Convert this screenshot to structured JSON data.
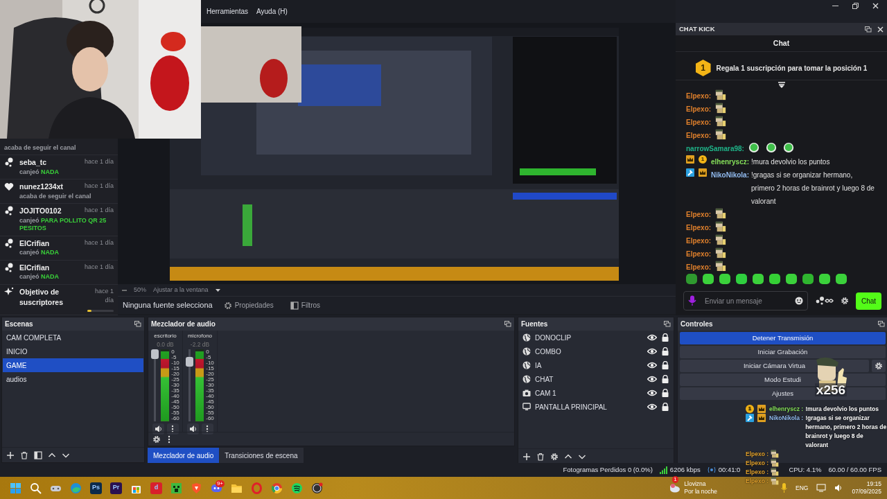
{
  "menu": [
    "Herramientas",
    "Ayuda (H)"
  ],
  "activity_feed": [
    {
      "kind": "follow",
      "text": "acaba de seguir el canal"
    },
    {
      "kind": "redeem",
      "user": "seba_tc",
      "time": "hace 1 día",
      "text": "canjeó",
      "reward": "NADA"
    },
    {
      "kind": "follow",
      "user": "nunez1234xt",
      "time": "hace 1 día",
      "text": "acaba de seguir el canal"
    },
    {
      "kind": "redeem",
      "user": "JOJITO0102",
      "time": "hace 1 día",
      "text": "canjeó",
      "reward": "PARA POLLITO QR 25 PESITOS"
    },
    {
      "kind": "redeem",
      "user": "ElCrifian",
      "time": "hace 1 día",
      "text": "canjeó",
      "reward": "NADA"
    },
    {
      "kind": "redeem",
      "user": "ElCrifian",
      "time": "hace 1 día",
      "text": "canjeó",
      "reward": "NADA"
    },
    {
      "kind": "goal",
      "user": "Objetivo de suscriptores",
      "time": "hace 1 día",
      "level": 0.15
    }
  ],
  "preview": {
    "kind": "picture",
    "zoom": "50%",
    "fit": "Ajustar a la ventana"
  },
  "source_toolbar": {
    "status": "Ninguna fuente selecciona",
    "buttons": [
      {
        "kind": "properties",
        "label": "Propiedades"
      },
      {
        "kind": "filters",
        "label": "Filtros"
      }
    ]
  },
  "chat": {
    "dock_title": "CHAT KICK",
    "title": "Chat",
    "pinned": {
      "badge": "1",
      "text": "Regala 1 suscripción para tomar la posición 1"
    },
    "messages": [
      {
        "kind": "pexo",
        "user": "Elpexo:",
        "color": "#e0802c"
      },
      {
        "kind": "pexo",
        "user": "Elpexo:",
        "color": "#e0802c"
      },
      {
        "kind": "pexo",
        "user": "Elpexo:",
        "color": "#e0802c"
      },
      {
        "kind": "pexo",
        "user": "Elpexo:",
        "color": "#e0802c"
      },
      {
        "kind": "zombies",
        "user": "narrowSamara98:",
        "color": "#1fb388"
      },
      {
        "kind": "text",
        "user": "elhenryscz:",
        "color": "#86e05a",
        "badges": [
          {
            "kind": "crown"
          },
          {
            "kind": "sub",
            "label": "1"
          }
        ],
        "text": "!mura devolvio los puntos"
      },
      {
        "kind": "text",
        "user": "NikoNikola:",
        "color": "#93bdf2",
        "badges": [
          {
            "kind": "mod"
          },
          {
            "kind": "crown"
          }
        ],
        "text": "!gragas si se organizar hermano, primero 2 horas de brainrot y luego 8 de valorant"
      },
      {
        "kind": "pexo",
        "user": "Elpexo:",
        "color": "#e0802c"
      },
      {
        "kind": "pexo",
        "user": "Elpexo:",
        "color": "#e0802c"
      },
      {
        "kind": "pexo",
        "user": "Elpexo:",
        "color": "#e0802c"
      },
      {
        "kind": "pexo",
        "user": "Elpexo:",
        "color": "#e0802c"
      },
      {
        "kind": "pexo",
        "user": "Elpexo:",
        "color": "#e0802c"
      }
    ],
    "input": {
      "placeholder": "Enviar un mensaje"
    },
    "send": "Chat"
  },
  "scenes": {
    "title": "Escenas",
    "items": [
      {
        "name": "CAM COMPLETA",
        "selected": false
      },
      {
        "name": "INICIO",
        "selected": false
      },
      {
        "name": "GAME",
        "selected": true
      },
      {
        "name": "audios",
        "selected": false
      }
    ]
  },
  "mixer": {
    "title": "Mezclador de audio",
    "channels": [
      {
        "name": "escritorio",
        "reading": "0.0 dB",
        "fader": {
          "level": 1.0
        },
        "meter": {
          "level": 0.97
        },
        "scale": [
          "0",
          "-5",
          "-10",
          "-15",
          "-20",
          "-25",
          "-30",
          "-35",
          "-40",
          "-45",
          "-50",
          "-55",
          "-60"
        ]
      },
      {
        "name": "microfono",
        "reading": "-2.2 dB",
        "fader": {
          "level": 0.85
        },
        "meter": {
          "level": 0.97
        },
        "scale": [
          "0",
          "-5",
          "-10",
          "-15",
          "-20",
          "-25",
          "-30",
          "-35",
          "-40",
          "-45",
          "-50",
          "-55",
          "-60"
        ]
      }
    ],
    "tabs": [
      {
        "label": "Mezclador de audio",
        "selected": true
      },
      {
        "label": "Transiciones de escena",
        "selected": false
      }
    ]
  },
  "sources": {
    "title": "Fuentes",
    "items": [
      {
        "name": "DONOCLIP",
        "kind": "browser",
        "visible": true,
        "locked": true
      },
      {
        "name": "COMBO",
        "kind": "browser",
        "visible": true,
        "locked": true
      },
      {
        "name": "IA",
        "kind": "browser",
        "visible": true,
        "locked": true
      },
      {
        "name": "CHAT",
        "kind": "browser",
        "visible": true,
        "locked": true
      },
      {
        "name": "CAM 1",
        "kind": "camera",
        "visible": true,
        "locked": true
      },
      {
        "name": "PANTALLA PRINCIPAL",
        "kind": "display",
        "visible": true,
        "locked": true
      }
    ]
  },
  "controls": {
    "title": "Controles",
    "buttons": [
      {
        "label": "Detener Transmisión",
        "active": true
      },
      {
        "label": "Iniciar Grabación",
        "active": false
      },
      {
        "label": "Iniciar Cámara Virtua",
        "active": false,
        "settings": true
      },
      {
        "label": "Modo Estudi",
        "active": false
      },
      {
        "label": "Ajustes",
        "active": false
      }
    ]
  },
  "status_bar": {
    "dropped": "Fotogramas Perdidos 0 (0.0%)",
    "bitrate": "6206 kbps",
    "time": "00:41:0",
    "cpu": "CPU: 4.1%",
    "fps": "60.00 / 60.00 FPS"
  },
  "overlay": {
    "gift": "x256",
    "messages": [
      {
        "user": "elhenryscz :",
        "color": "#86e05a",
        "badges": [
          {
            "kind": "sub",
            "label": "1"
          },
          {
            "kind": "crown"
          }
        ],
        "text": "!mura devolvio los puntos"
      },
      {
        "user": "NikoNikola :",
        "color": "#93bdf2",
        "badges": [
          {
            "kind": "mod"
          },
          {
            "kind": "crown"
          }
        ],
        "text": "!gragas si se organizar hermano, primero 2 horas de brainrot y luego 8 de valorant"
      },
      {
        "user": "Elpexo :",
        "color": "#e0a02c"
      },
      {
        "user": "Elpexo :",
        "color": "#e0a02c"
      },
      {
        "user": "Elpexo :",
        "color": "#e0a02c"
      },
      {
        "user": "Elpexo :",
        "color": "#e0a02c"
      }
    ]
  },
  "taskbar": {
    "apps": [
      {
        "kind": "start"
      },
      {
        "kind": "search"
      },
      {
        "kind": "gamepad"
      },
      {
        "kind": "browser"
      },
      {
        "kind": "tile",
        "label": "Ps",
        "color": "#0b2a4a"
      },
      {
        "kind": "tile",
        "label": "Pr",
        "color": "#2a1150"
      },
      {
        "kind": "store"
      },
      {
        "kind": "tile",
        "label": "d",
        "color": "#d8202c"
      },
      {
        "kind": "block"
      },
      {
        "kind": "shield"
      },
      {
        "kind": "chat",
        "badge": "9+"
      },
      {
        "kind": "folder"
      },
      {
        "kind": "ring"
      },
      {
        "kind": "wheel"
      },
      {
        "kind": "music"
      },
      {
        "kind": "record"
      }
    ],
    "weather": {
      "text": "Llovizna",
      "sub": "Por la noche",
      "badge": "1"
    },
    "language": "ENG",
    "clock": "19:15",
    "date": "07/09/2025"
  }
}
